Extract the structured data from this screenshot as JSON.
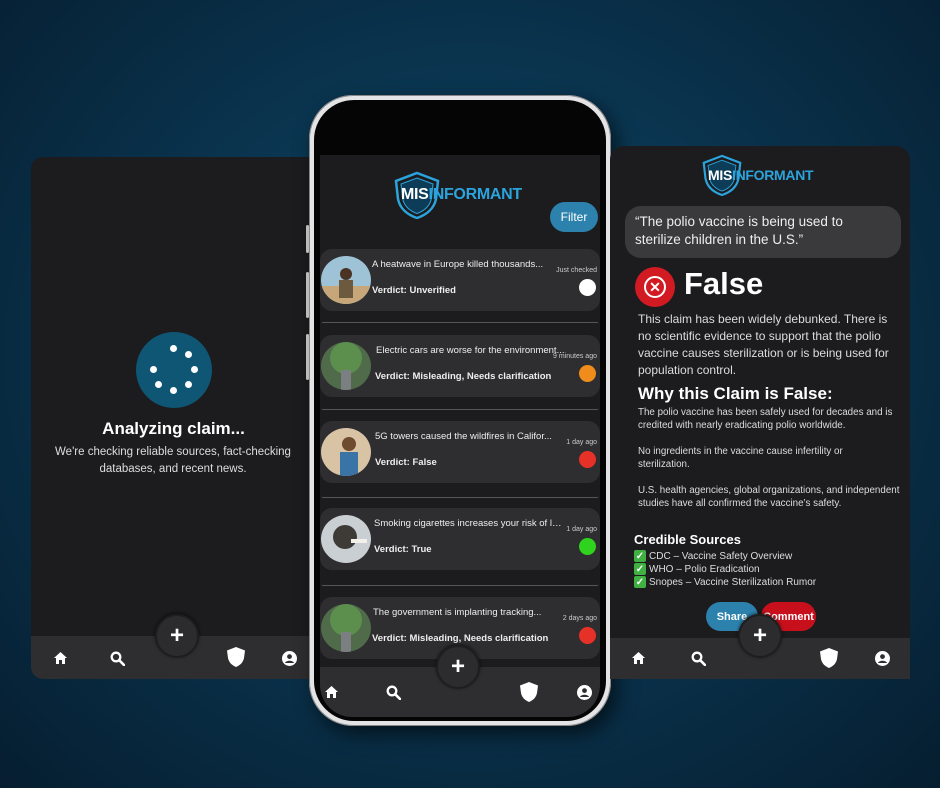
{
  "left_screen": {
    "title": "Analyzing claim...",
    "subtitle": "We're checking reliable sources, fact-checking databases, and recent news."
  },
  "logo": {
    "part1": "MIS",
    "part2": "INFORMANT"
  },
  "feed": {
    "filter_label": "Filter",
    "cards": [
      {
        "title": "A heatwave in Europe killed thousands...",
        "verdict": "Verdict: Unverified",
        "time": "Just checked",
        "status_color": "#ffffff"
      },
      {
        "title": "Electric cars are worse for the environment...",
        "verdict": "Verdict: Misleading, Needs clarification",
        "time": "9 minutes ago",
        "status_color": "#f08c1c"
      },
      {
        "title": "5G towers caused the wildfires in Califor...",
        "verdict": "Verdict: False",
        "time": "1 day ago",
        "status_color": "#e53127"
      },
      {
        "title": "Smoking cigarettes increases your risk of lun...",
        "verdict": "Verdict: True",
        "time": "1 day ago",
        "status_color": "#2fd21c"
      },
      {
        "title": "The government is implanting tracking...",
        "verdict": "Verdict: Misleading, Needs clarification",
        "time": "2 days ago",
        "status_color": "#e53127"
      }
    ]
  },
  "detail": {
    "claim": "“The polio vaccine is being used to sterilize children in the U.S.”",
    "verdict_word": "False",
    "summary": "This claim has been widely debunked. There is no scientific evidence to support that the polio vaccine causes sterilization or is being used for population control.",
    "why_title": "Why this Claim is False:",
    "reasons": [
      "The polio vaccine has been safely used for decades and is credited with nearly eradicating polio worldwide.",
      "No ingredients in the vaccine cause infertility or sterilization.",
      "U.S. health agencies, global organizations, and independent studies have all confirmed the vaccine’s safety."
    ],
    "sources_title": "Credible  Sources",
    "sources": [
      "CDC – Vaccine Safety Overview",
      "WHO – Polio Eradication",
      "Snopes – Vaccine Sterilization Rumor"
    ],
    "share_label": "Share",
    "comment_label": "Comment"
  },
  "nav": {
    "items": [
      "home-icon",
      "search-icon",
      "plus-icon",
      "shield-icon",
      "profile-icon"
    ],
    "add_symbol": "+"
  },
  "colors": {
    "accent_blue": "#2c82ad",
    "false_red": "#d11a22",
    "logo_blue": "#2ba3dc"
  }
}
